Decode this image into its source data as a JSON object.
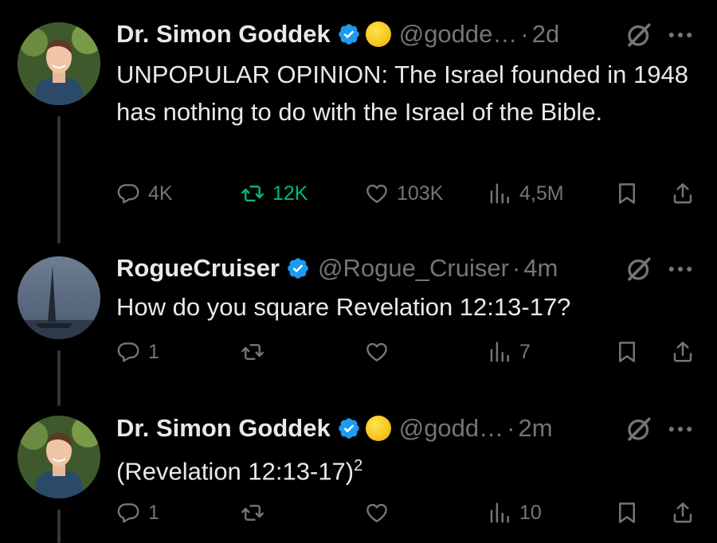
{
  "tweets": [
    {
      "name": "Dr. Simon Goddek",
      "handle": "@godde…",
      "separator": "·",
      "time": "2d",
      "text": "UNPOPULAR OPINION: The Israel founded in 1948 has nothing to do with the Israel of the Bible.",
      "replies": "4K",
      "retweets": "12K",
      "likes": "103K",
      "views": "4,5M",
      "retweeted": true
    },
    {
      "name": "RogueCruiser",
      "handle": "@Rogue_Cruiser",
      "separator": "·",
      "time": "4m",
      "text": "How do you square Revelation 12:13-17?",
      "replies": "1",
      "retweets": "",
      "likes": "",
      "views": "7",
      "retweeted": false
    },
    {
      "name": "Dr. Simon Goddek",
      "handle": "@godd…",
      "separator": "·",
      "time": "2m",
      "text": "(Revelation 12:13-17)",
      "text_sup": "2",
      "replies": "1",
      "retweets": "",
      "likes": "",
      "views": "10",
      "retweeted": false
    }
  ],
  "colors": {
    "background": "#000000",
    "text": "#e7e9ea",
    "muted": "#71767b",
    "verified": "#1d9bf0",
    "retweet_active": "#00ba7c"
  }
}
